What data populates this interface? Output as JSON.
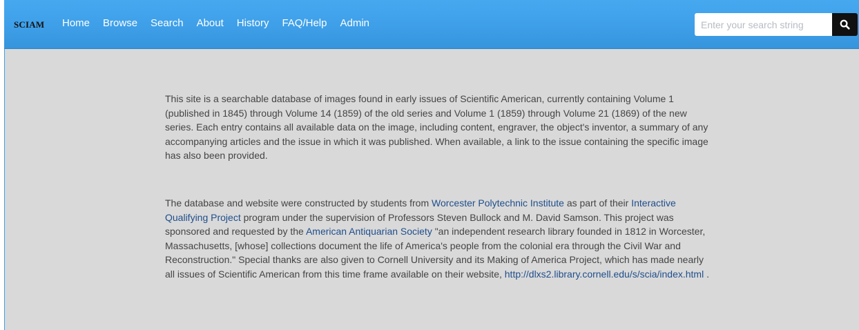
{
  "navbar": {
    "brand": "SCIAM",
    "links": [
      "Home",
      "Browse",
      "Search",
      "About",
      "History",
      "FAQ/Help",
      "Admin"
    ],
    "search_placeholder": "Enter your search string",
    "search_icon": "search-icon",
    "background_color": "#3e9fe8"
  },
  "main": {
    "background_color": "#d9d9d9",
    "paragraph1": "This site is a searchable database of images found in early issues of Scientific American, currently containing Volume 1 (published in 1845) through Volume 14 (1859) of the old series and Volume 1 (1859) through Volume 21 (1869) of the new series. Each entry contains all available data on the image, including content, engraver, the object's inventor, a summary of any accompanying articles and the issue in which it was published. When available, a link to the issue containing the specific image has also been provided.",
    "paragraph2": {
      "t1": "The database and website were constructed by students from ",
      "link1": "Worcester Polytechnic Institute",
      "t2": " as part of their ",
      "link2": "Interactive Qualifying Project",
      "t3": " program under the supervision of Professors Steven Bullock and M. David Samson. This project was sponsored and requested by the ",
      "link3": "American Antiquarian Society",
      "t4": " \"an independent research library founded in 1812 in Worcester, Massachusetts, [whose] collections document the life of America's people from the colonial era through the Civil War and Reconstruction.\" Special thanks are also given to Cornell University and its Making of America Project, which has made nearly all issues of Scientific American from this time frame available on their website, ",
      "link4": "http://dlxs2.library.cornell.edu/s/scia/index.html",
      "t5": " ."
    },
    "link_color": "#1f4e8c"
  }
}
